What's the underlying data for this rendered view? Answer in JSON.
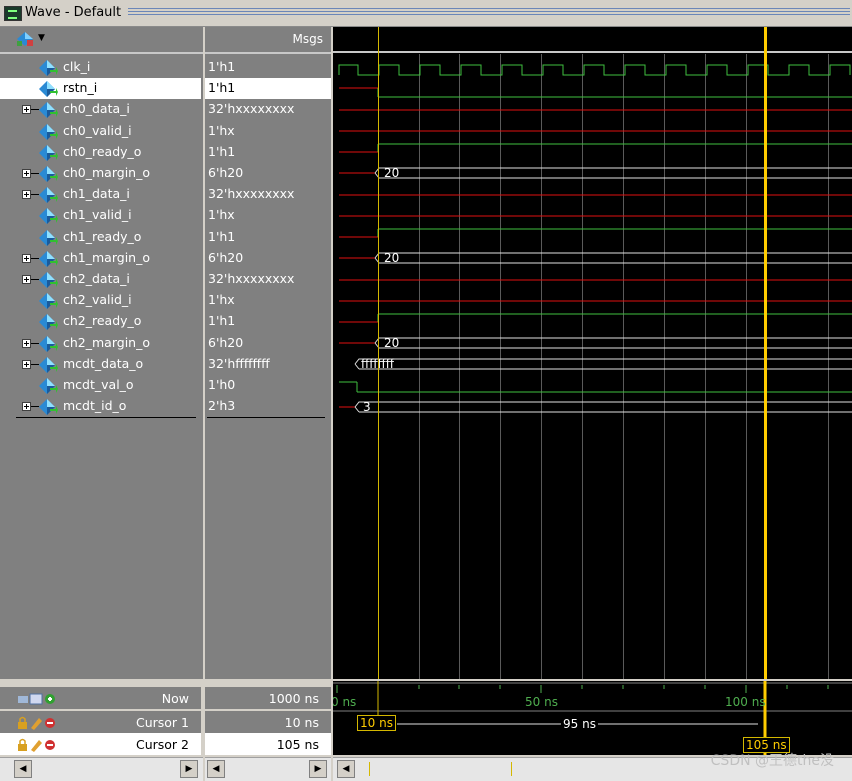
{
  "window": {
    "title": "Wave - Default"
  },
  "header": {
    "msgs_label": "Msgs"
  },
  "signals": [
    {
      "name": "clk_i",
      "value": "1'h1",
      "expandable": false,
      "selected": false
    },
    {
      "name": "rstn_i",
      "value": "1'h1",
      "expandable": false,
      "selected": true
    },
    {
      "name": "ch0_data_i",
      "value": "32'hxxxxxxxx",
      "expandable": true,
      "selected": false
    },
    {
      "name": "ch0_valid_i",
      "value": "1'hx",
      "expandable": false,
      "selected": false
    },
    {
      "name": "ch0_ready_o",
      "value": "1'h1",
      "expandable": false,
      "selected": false
    },
    {
      "name": "ch0_margin_o",
      "value": "6'h20",
      "expandable": true,
      "selected": false
    },
    {
      "name": "ch1_data_i",
      "value": "32'hxxxxxxxx",
      "expandable": true,
      "selected": false
    },
    {
      "name": "ch1_valid_i",
      "value": "1'hx",
      "expandable": false,
      "selected": false
    },
    {
      "name": "ch1_ready_o",
      "value": "1'h1",
      "expandable": false,
      "selected": false
    },
    {
      "name": "ch1_margin_o",
      "value": "6'h20",
      "expandable": true,
      "selected": false
    },
    {
      "name": "ch2_data_i",
      "value": "32'hxxxxxxxx",
      "expandable": true,
      "selected": false
    },
    {
      "name": "ch2_valid_i",
      "value": "1'hx",
      "expandable": false,
      "selected": false
    },
    {
      "name": "ch2_ready_o",
      "value": "1'h1",
      "expandable": false,
      "selected": false
    },
    {
      "name": "ch2_margin_o",
      "value": "6'h20",
      "expandable": true,
      "selected": false
    },
    {
      "name": "mcdt_data_o",
      "value": "32'hffffffff",
      "expandable": true,
      "selected": false
    },
    {
      "name": "mcdt_val_o",
      "value": "1'h0",
      "expandable": false,
      "selected": false
    },
    {
      "name": "mcdt_id_o",
      "value": "2'h3",
      "expandable": true,
      "selected": false
    }
  ],
  "wave_labels": {
    "ch0_margin": "20",
    "ch1_margin": "20",
    "ch2_margin": "20",
    "mcdt_data": "ffffffff",
    "mcdt_id": "3"
  },
  "bottom": {
    "now_label": "Now",
    "now_value": "1000 ns",
    "cursor1_label": "Cursor 1",
    "cursor1_value": "10 ns",
    "cursor2_label": "Cursor 2",
    "cursor2_value": "105 ns",
    "tick_labels": [
      "0 ns",
      "50 ns",
      "100 ns"
    ],
    "cursor1_box": "10 ns",
    "cursor2_box": "105 ns",
    "delta_label": "95 ns"
  },
  "watermark": "CSDN @王德the没",
  "colors": {
    "clock_green": "#3fbf3f",
    "red_signal": "#e01010",
    "bus_white": "#e0e0e0",
    "cursor_yellow": "#ffcc00",
    "time_green": "#4fae4f"
  },
  "icons": {
    "signal": "diamond-arrow-icon",
    "toolbar": "signal-tree-icon",
    "now": "now-icons",
    "cursor": "lock-pencil-delete-icons"
  }
}
